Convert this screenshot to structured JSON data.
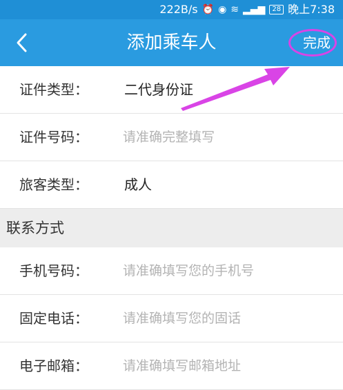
{
  "status_bar": {
    "speed": "222B/s",
    "battery": "28",
    "time": "晚上7:38"
  },
  "header": {
    "back_icon": "chevron-left-icon",
    "title": "添加乘车人",
    "done_label": "完成"
  },
  "form": {
    "id_type": {
      "label": "证件类型：",
      "value": "二代身份证"
    },
    "id_number": {
      "label": "证件号码：",
      "placeholder": "请准确完整填写"
    },
    "passenger_type": {
      "label": "旅客类型：",
      "value": "成人"
    }
  },
  "contact": {
    "section_title": "联系方式",
    "mobile": {
      "label": "手机号码：",
      "placeholder": "请准确填写您的手机号"
    },
    "landline": {
      "label": "固定电话：",
      "placeholder": "请准确填写您的固话"
    },
    "email": {
      "label": "电子邮箱：",
      "placeholder": "请准确填写邮箱地址"
    }
  },
  "colors": {
    "header_bg": "#2a9be0",
    "annotation": "#d944e6"
  }
}
